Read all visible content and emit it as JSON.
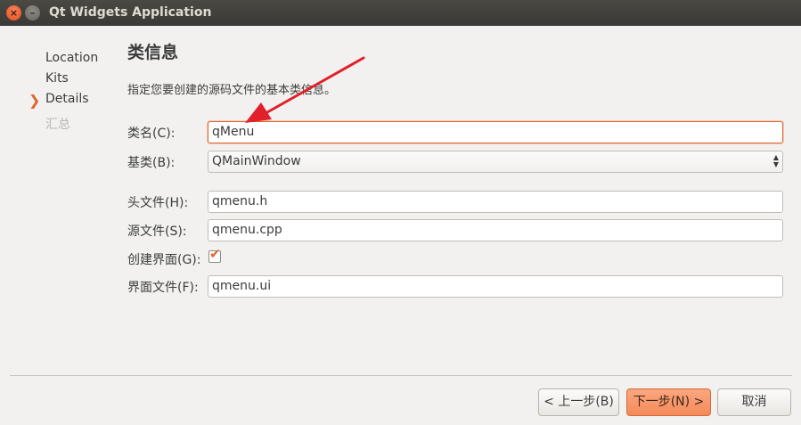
{
  "window": {
    "title": "Qt Widgets Application",
    "close_glyph": "×",
    "minimize_glyph": "–"
  },
  "steps": [
    {
      "label": "Location",
      "state": "done"
    },
    {
      "label": "Kits",
      "state": "done"
    },
    {
      "label": "Details",
      "state": "current",
      "marker": "❯"
    },
    {
      "label": "汇总",
      "state": "pending"
    }
  ],
  "page": {
    "title": "类信息",
    "description": "指定您要创建的源码文件的基本类信息。"
  },
  "form": {
    "class_name": {
      "label": "类名(C):",
      "value": "qMenu"
    },
    "base_class": {
      "label": "基类(B):",
      "value": "QMainWindow"
    },
    "header_file": {
      "label": "头文件(H):",
      "value": "qmenu.h"
    },
    "source_file": {
      "label": "源文件(S):",
      "value": "qmenu.cpp"
    },
    "create_form": {
      "label": "创建界面(G):",
      "checked": true,
      "check_glyph": "✔"
    },
    "form_file": {
      "label": "界面文件(F):",
      "value": "qmenu.ui"
    }
  },
  "buttons": {
    "back": "< 上一步(B)",
    "next": "下一步(N) >",
    "cancel": "取消"
  },
  "colors": {
    "accent": "#e0642d",
    "annotation_arrow": "#e0202a"
  }
}
